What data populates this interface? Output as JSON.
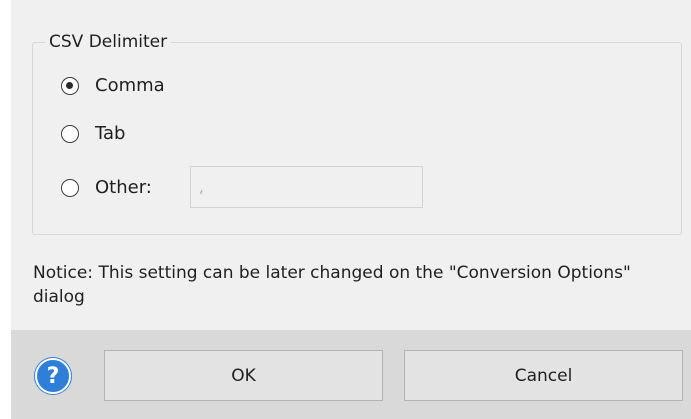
{
  "group": {
    "title": "CSV Delimiter",
    "options": [
      {
        "label": "Comma",
        "checked": true
      },
      {
        "label": "Tab",
        "checked": false
      },
      {
        "label": "Other:",
        "checked": false
      }
    ],
    "other_value": ","
  },
  "notice": "Notice: This setting can be later changed on the \"Conversion Options\" dialog",
  "footer": {
    "help_icon": "question-mark-icon",
    "help_symbol": "?",
    "ok_label": "OK",
    "cancel_label": "Cancel"
  },
  "colors": {
    "dialog_bg": "#f0f0f0",
    "footer_bg": "#d9d9d9",
    "help_blue": "#2f7fd9"
  }
}
